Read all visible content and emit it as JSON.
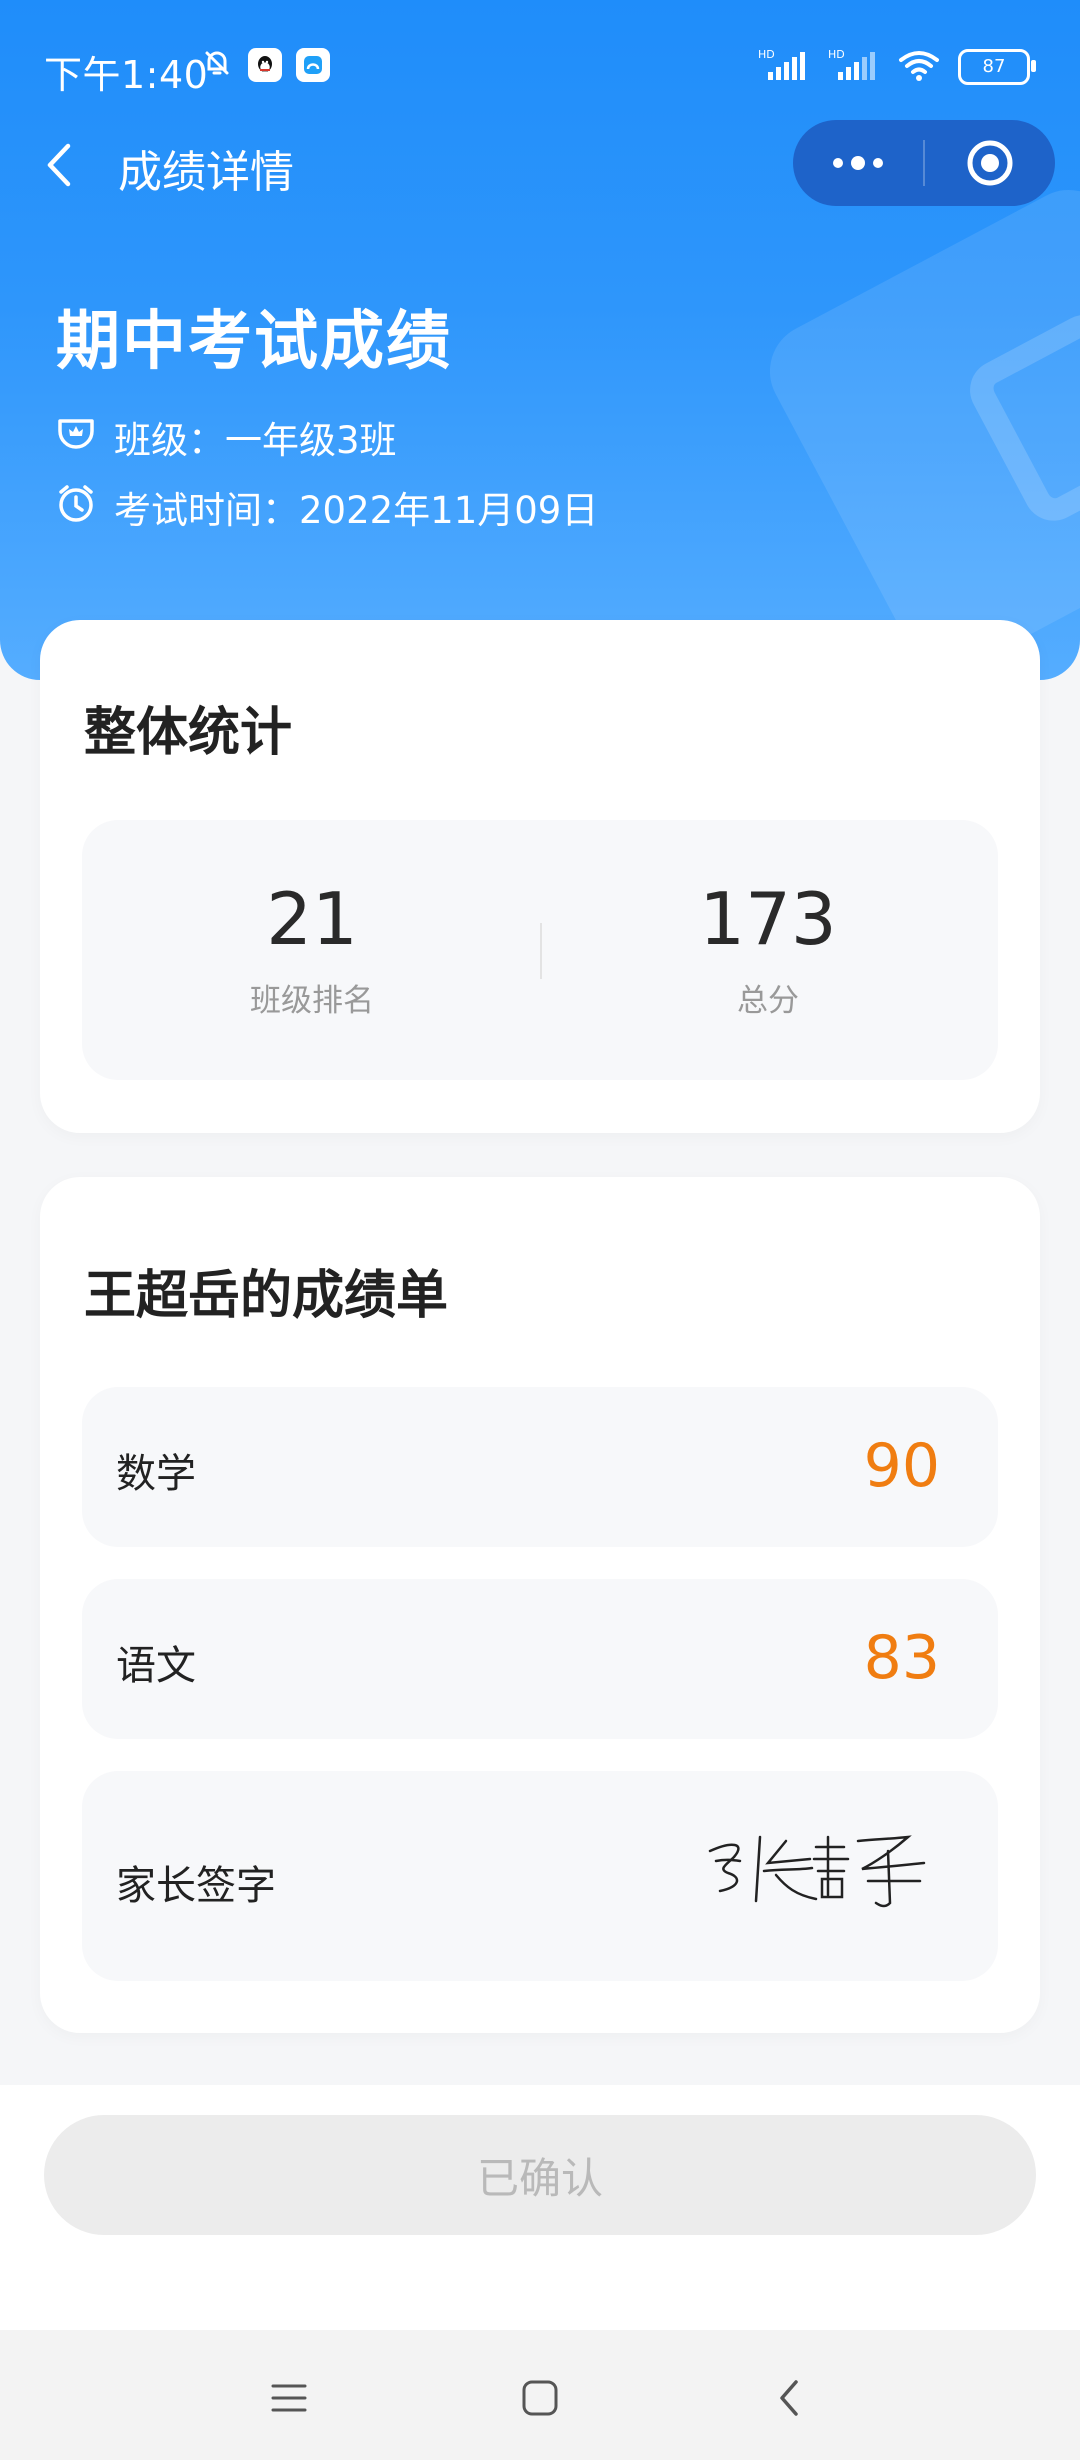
{
  "status_bar": {
    "time": "下午1:40",
    "battery": "87",
    "signal_label_1": "HD",
    "signal_label_2": "HD"
  },
  "header": {
    "title": "成绩详情"
  },
  "exam": {
    "title": "期中考试成绩",
    "class_label": "班级：一年级3班",
    "time_label": "考试时间：2022年11月09日"
  },
  "overall": {
    "title": "整体统计",
    "rank": {
      "value": "21",
      "label": "班级排名"
    },
    "total": {
      "value": "173",
      "label": "总分"
    }
  },
  "report": {
    "title": "王超岳的成绩单",
    "subjects": [
      {
        "name": "数学",
        "score": "90"
      },
      {
        "name": "语文",
        "score": "83"
      }
    ],
    "signature": {
      "label": "家长签字",
      "text": "张静"
    }
  },
  "confirm": {
    "label": "已确认"
  },
  "colors": {
    "primary": "#1f8dfa",
    "score": "#f07d11",
    "disabled_bg": "#ececec",
    "disabled_text": "#b9b9b9"
  },
  "icons": {
    "back": "chevron-left-icon",
    "more": "more-dots-icon",
    "close": "target-close-icon",
    "class": "class-badge-icon",
    "clock": "alarm-clock-icon",
    "menu": "menu-icon",
    "home": "home-icon",
    "nav_back": "back-icon"
  }
}
